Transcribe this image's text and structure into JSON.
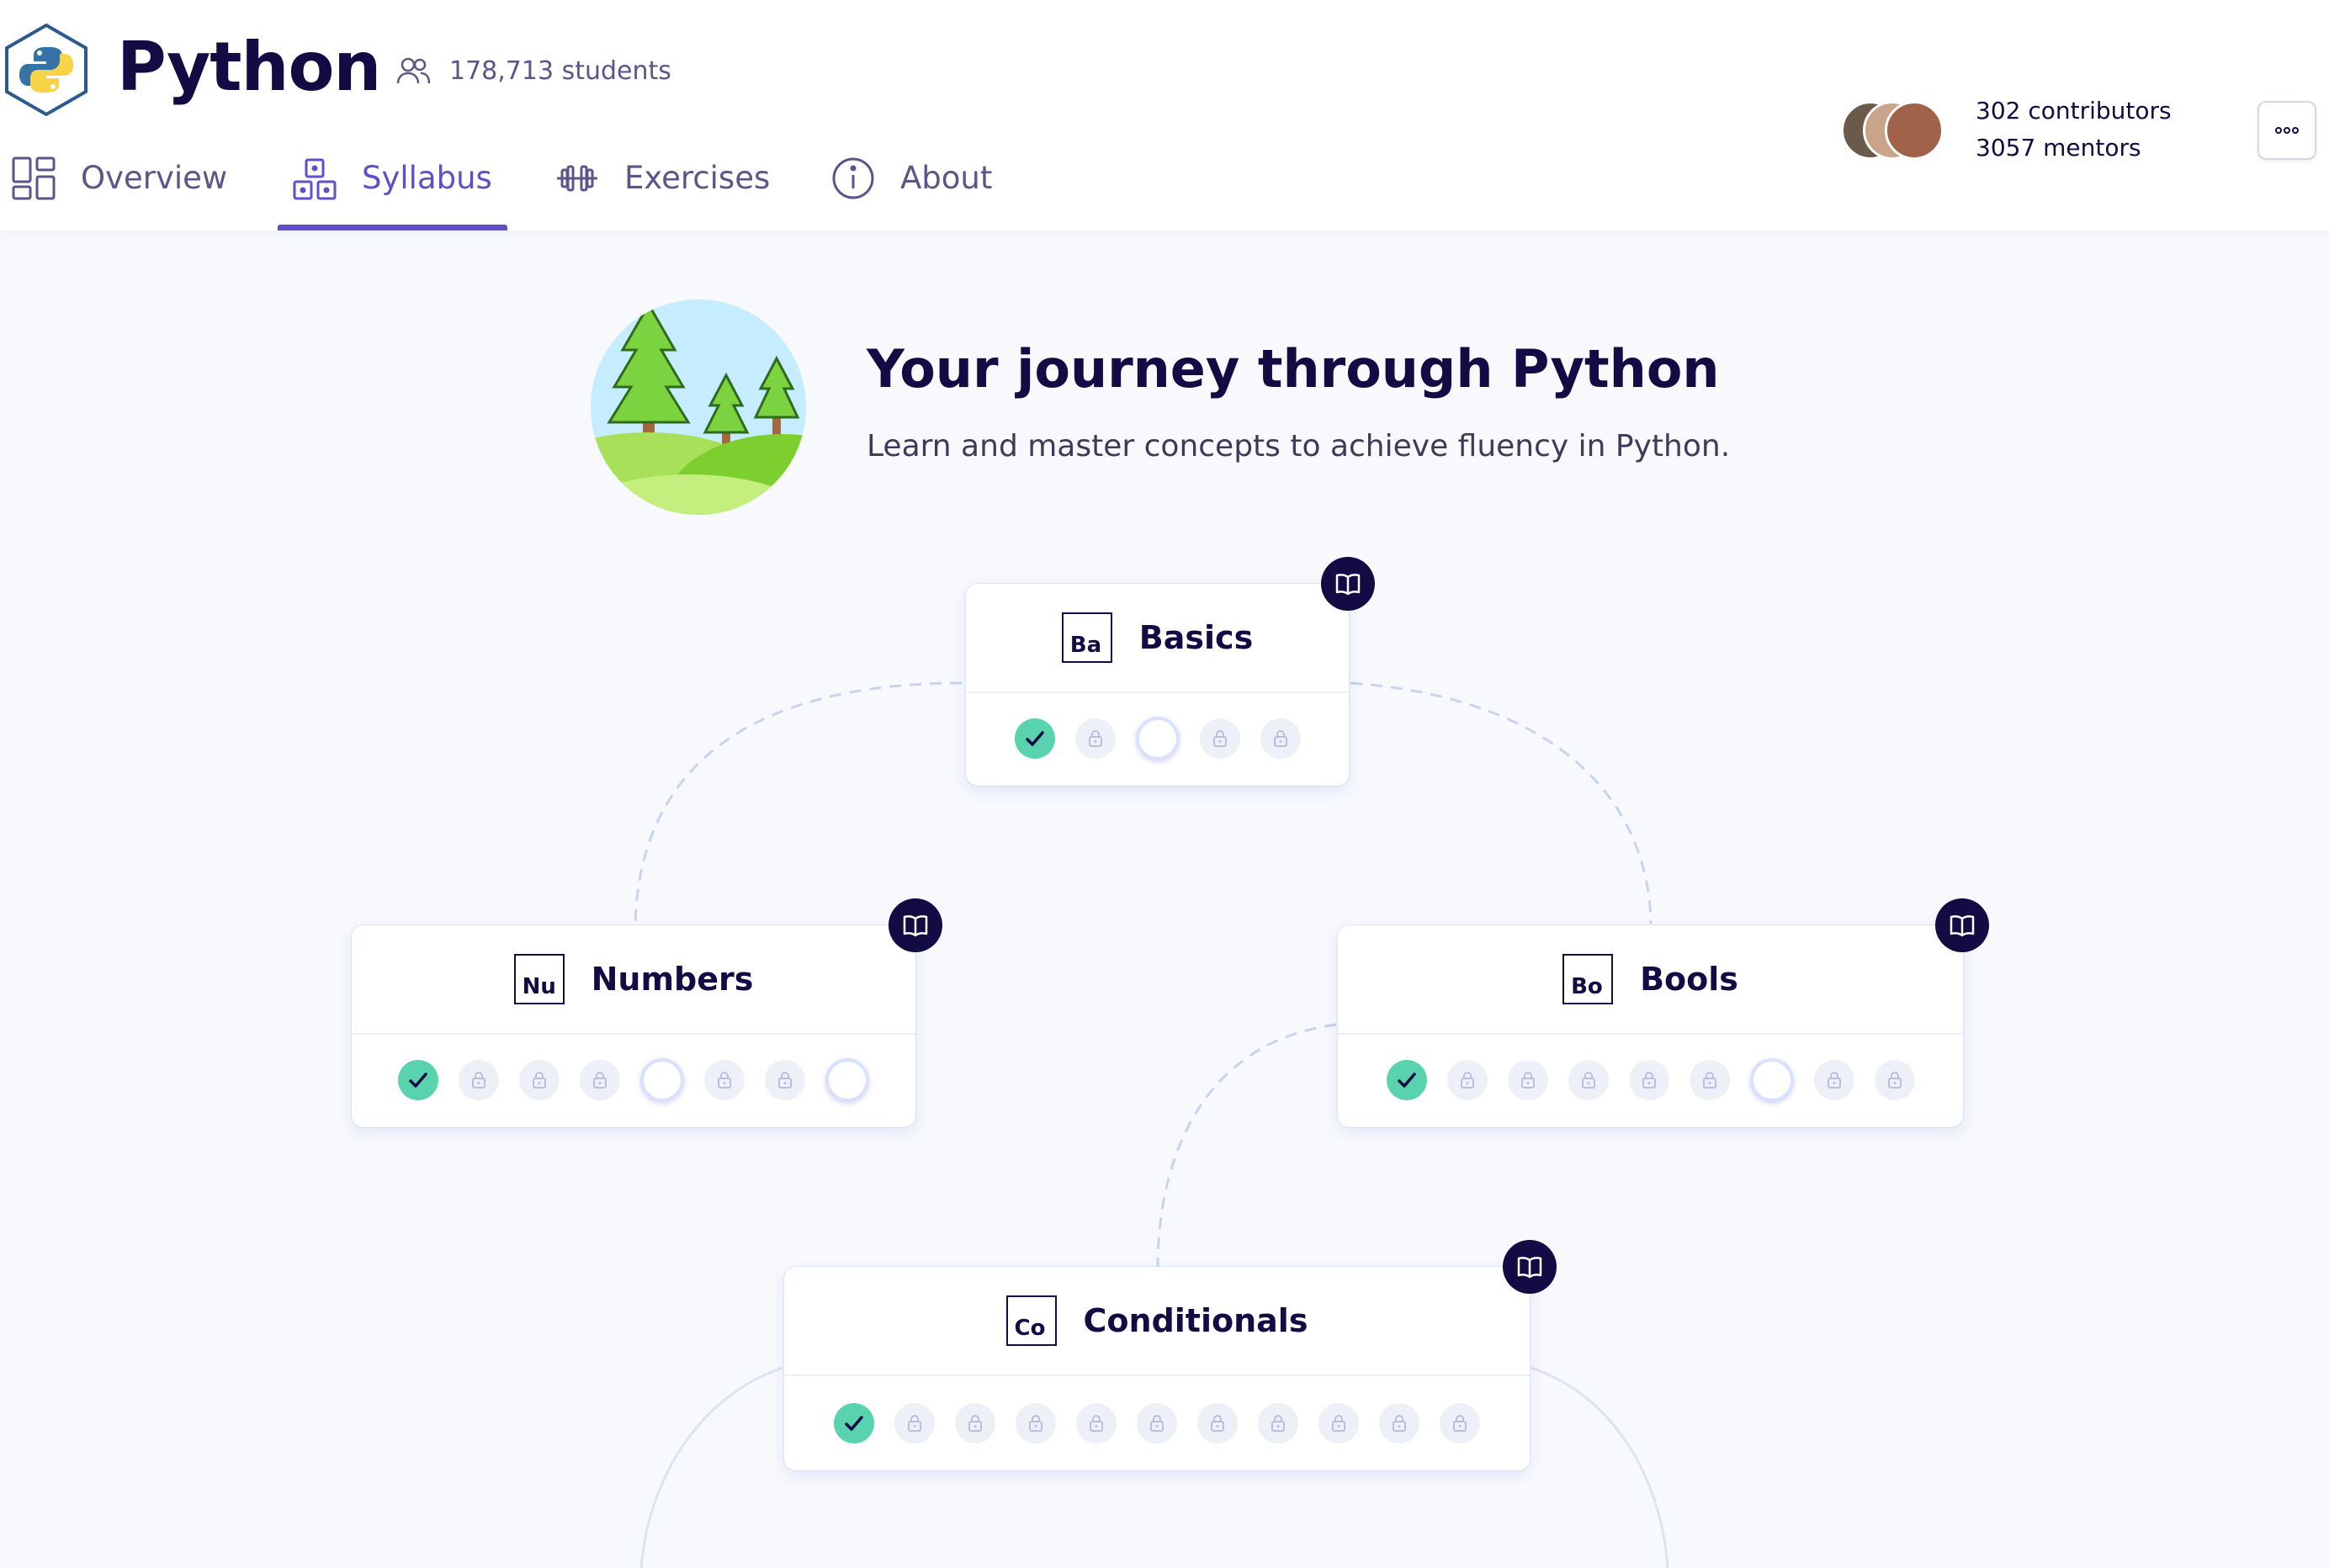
{
  "header": {
    "title": "Python",
    "students": "178,713 students",
    "contributors": "302 contributors",
    "mentors": "3057 mentors",
    "tabs": [
      {
        "label": "Overview",
        "icon": "overview-icon",
        "active": false
      },
      {
        "label": "Syllabus",
        "icon": "syllabus-icon",
        "active": true
      },
      {
        "label": "Exercises",
        "icon": "dumbbell-icon",
        "active": false
      },
      {
        "label": "About",
        "icon": "info-icon",
        "active": false
      }
    ]
  },
  "hero": {
    "title": "Your journey through Python",
    "subtitle": "Learn and master concepts to achieve fluency in Python."
  },
  "concepts": [
    {
      "abbr": "Ba",
      "name": "Basics",
      "exercises": [
        "done",
        "locked",
        "open",
        "locked",
        "locked"
      ]
    },
    {
      "abbr": "Nu",
      "name": "Numbers",
      "exercises": [
        "done",
        "locked",
        "locked",
        "locked",
        "open",
        "locked",
        "locked",
        "open"
      ]
    },
    {
      "abbr": "Bo",
      "name": "Bools",
      "exercises": [
        "done",
        "locked",
        "locked",
        "locked",
        "locked",
        "locked",
        "open",
        "locked",
        "locked"
      ]
    },
    {
      "abbr": "Co",
      "name": "Conditionals",
      "exercises": [
        "done",
        "locked",
        "locked",
        "locked",
        "locked",
        "locked",
        "locked",
        "locked",
        "locked",
        "locked",
        "locked"
      ]
    }
  ],
  "colors": {
    "accent": "#604fcd",
    "text": "#130b43",
    "done": "#59d2ae",
    "background": "#f8f9fd"
  }
}
